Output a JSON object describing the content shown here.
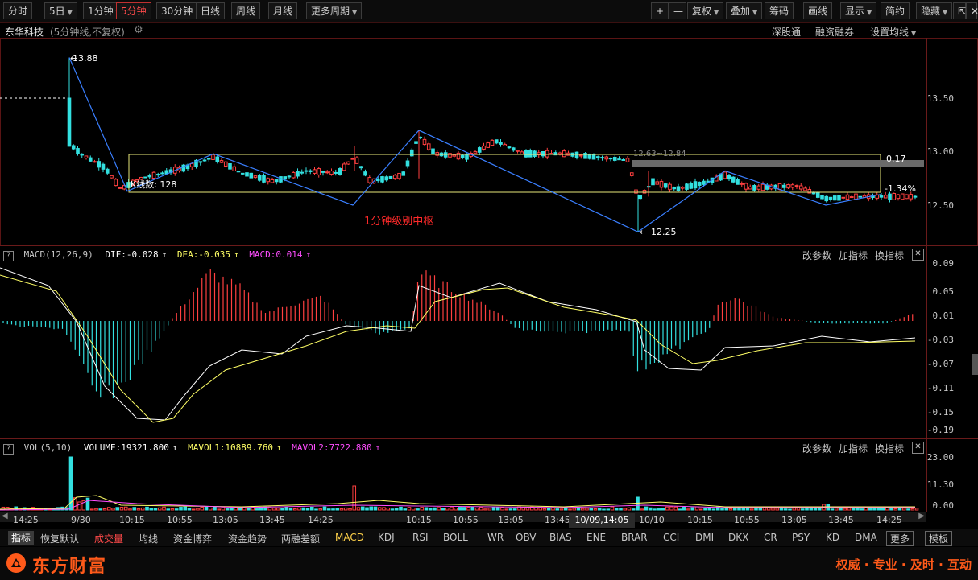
{
  "toolbar": {
    "periods": [
      "分时",
      "5日",
      "1分钟",
      "5分钟",
      "30分钟",
      "日线",
      "周线",
      "月线",
      "更多周期"
    ],
    "active_period": "5分钟",
    "right": [
      "复权",
      "叠加",
      "筹码",
      "画线",
      "显示",
      "简约",
      "隐藏"
    ],
    "plus": "+",
    "minus": "—",
    "restore": "⇱",
    "close": "✕"
  },
  "title": {
    "stock": "东华科技",
    "mode": "(5分钟线,不复权)",
    "links": [
      "深股通",
      "融资融券",
      "设置均线"
    ]
  },
  "main_chart": {
    "annotations": {
      "high": "13.88",
      "low": "12.25",
      "kcount": "K线数: 128",
      "zone_label": "1分钟级别中枢",
      "box_top": "0.17",
      "box_bottom": "-1.34%",
      "overlay_text": "12.63~12.84"
    },
    "yaxis": [
      "13.50",
      "13.00",
      "12.50"
    ],
    "colors": {
      "up": "#ff4040",
      "down": "#33e0e0",
      "box": "#e8e87a",
      "zone_label": "#ff2a2a",
      "stroke": "#3a7fff"
    }
  },
  "macd": {
    "name": "MACD(12,26,9)",
    "dif": "DIF:-0.028",
    "dea": "DEA:-0.035",
    "macd": "MACD:0.014",
    "buttons": [
      "改参数",
      "加指标",
      "换指标"
    ],
    "yaxis": [
      "0.09",
      "0.05",
      "0.01",
      "-0.03",
      "-0.07",
      "-0.11",
      "-0.15",
      "-0.19"
    ]
  },
  "vol": {
    "name": "VOL(5,10)",
    "volume": "VOLUME:19321.800",
    "mavol1": "MAVOL1:10889.760",
    "mavol2": "MAVOL2:7722.880",
    "buttons": [
      "改参数",
      "加指标",
      "换指标"
    ],
    "yaxis": [
      "23.00",
      "11.30",
      "0.00"
    ]
  },
  "arrow_glyph": "↑",
  "help_glyph": "?",
  "close_glyph": "✕",
  "xaxis": {
    "labels": [
      "14:25",
      "9/30",
      "10:15",
      "10:55",
      "13:05",
      "13:45",
      "14:25",
      "10:15",
      "10:55",
      "13:05",
      "13:45",
      "10/10",
      "10:15",
      "10:55",
      "13:05",
      "13:45",
      "14:25"
    ],
    "cursor": "10/09,14:05"
  },
  "tabs": {
    "items": [
      "指标",
      "恢复默认",
      "成交量",
      "均线",
      "资金博弈",
      "资金趋势",
      "两融差额",
      "MACD",
      "KDJ",
      "RSI",
      "BOLL",
      "WR",
      "OBV",
      "BIAS",
      "ENE",
      "BRAR",
      "CCI",
      "DMI",
      "DKX",
      "CR",
      "PSY",
      "KD",
      "DMA",
      "更多",
      "模板"
    ],
    "selected": "MACD",
    "highlight": "成交量"
  },
  "footer": {
    "brand": "东方财富",
    "slogan": "权威 · 专业 · 及时 · 互动"
  }
}
